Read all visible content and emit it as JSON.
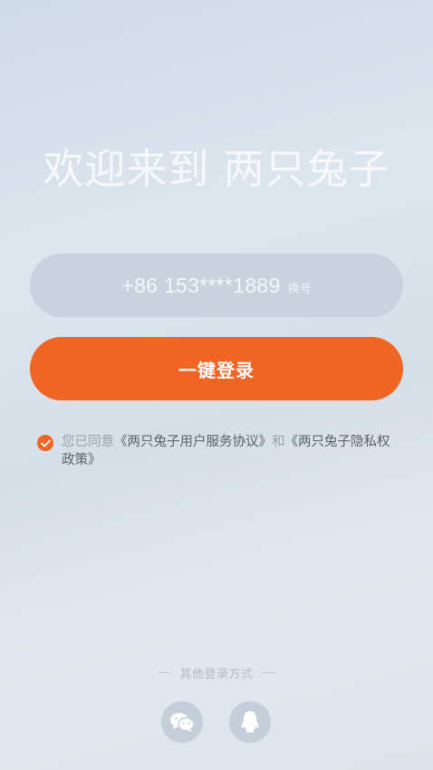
{
  "welcome": {
    "title": "欢迎来到 两只兔子"
  },
  "phone": {
    "number": "+86 153****1889",
    "switch_label": "换号"
  },
  "login": {
    "button_label": "一键登录"
  },
  "agreement": {
    "checked": true,
    "prefix": "您已同意",
    "user_agreement": "《两只兔子用户服务协议》",
    "conjunction": "和",
    "privacy_policy": "《两只兔子隐私权政策》"
  },
  "other_login": {
    "label": "其他登录方式",
    "methods": [
      {
        "name": "wechat",
        "icon": "wechat-icon"
      },
      {
        "name": "qq",
        "icon": "qq-icon"
      }
    ]
  },
  "colors": {
    "accent": "#f06424",
    "background_top": "#cfdbe6",
    "background_bottom": "#dce3ea"
  }
}
